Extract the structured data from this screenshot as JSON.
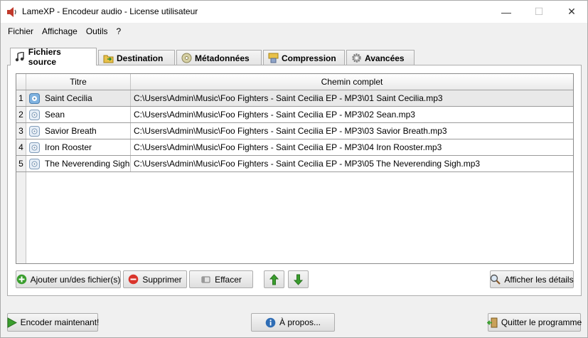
{
  "window": {
    "title": "LameXP - Encodeur audio - License utilisateur",
    "controls": {
      "minimize": "—",
      "maximize": "☐",
      "close": "✕"
    }
  },
  "menu": [
    "Fichier",
    "Affichage",
    "Outils",
    "?"
  ],
  "tabs": [
    {
      "label": "Fichiers source",
      "icon": "music-note-icon",
      "active": true
    },
    {
      "label": "Destination",
      "icon": "folder-arrow-icon",
      "active": false
    },
    {
      "label": "Métadonnées",
      "icon": "disc-icon",
      "active": false
    },
    {
      "label": "Compression",
      "icon": "press-icon",
      "active": false
    },
    {
      "label": "Avancées",
      "icon": "gear-icon",
      "active": false
    }
  ],
  "table": {
    "columns": [
      "Titre",
      "Chemin complet"
    ],
    "rows": [
      {
        "num": "1",
        "title": "Saint Cecilia",
        "path": "C:\\Users\\Admin\\Music\\Foo Fighters - Saint Cecilia EP - MP3\\01 Saint Cecilia.mp3",
        "selected": true
      },
      {
        "num": "2",
        "title": "Sean",
        "path": "C:\\Users\\Admin\\Music\\Foo Fighters - Saint Cecilia EP - MP3\\02 Sean.mp3",
        "selected": false
      },
      {
        "num": "3",
        "title": "Savior Breath",
        "path": "C:\\Users\\Admin\\Music\\Foo Fighters - Saint Cecilia EP - MP3\\03 Savior Breath.mp3",
        "selected": false
      },
      {
        "num": "4",
        "title": "Iron Rooster",
        "path": "C:\\Users\\Admin\\Music\\Foo Fighters - Saint Cecilia EP - MP3\\04 Iron Rooster.mp3",
        "selected": false
      },
      {
        "num": "5",
        "title": "The Neverending Sigh",
        "path": "C:\\Users\\Admin\\Music\\Foo Fighters - Saint Cecilia EP - MP3\\05 The Neverending Sigh.mp3",
        "selected": false
      }
    ]
  },
  "panel_buttons": {
    "add": "Ajouter un/des fichier(s)",
    "remove": "Supprimer",
    "clear": "Effacer",
    "show_details": "Afficher les détails"
  },
  "bottom_buttons": {
    "encode": "Encoder maintenant!",
    "about": "À propos...",
    "quit": "Quitter le programme"
  },
  "colors": {
    "accent_green": "#3a9e2e",
    "remove_red": "#d9342b",
    "info_blue": "#2f6db5",
    "selected_row": "#e9e9e9"
  }
}
